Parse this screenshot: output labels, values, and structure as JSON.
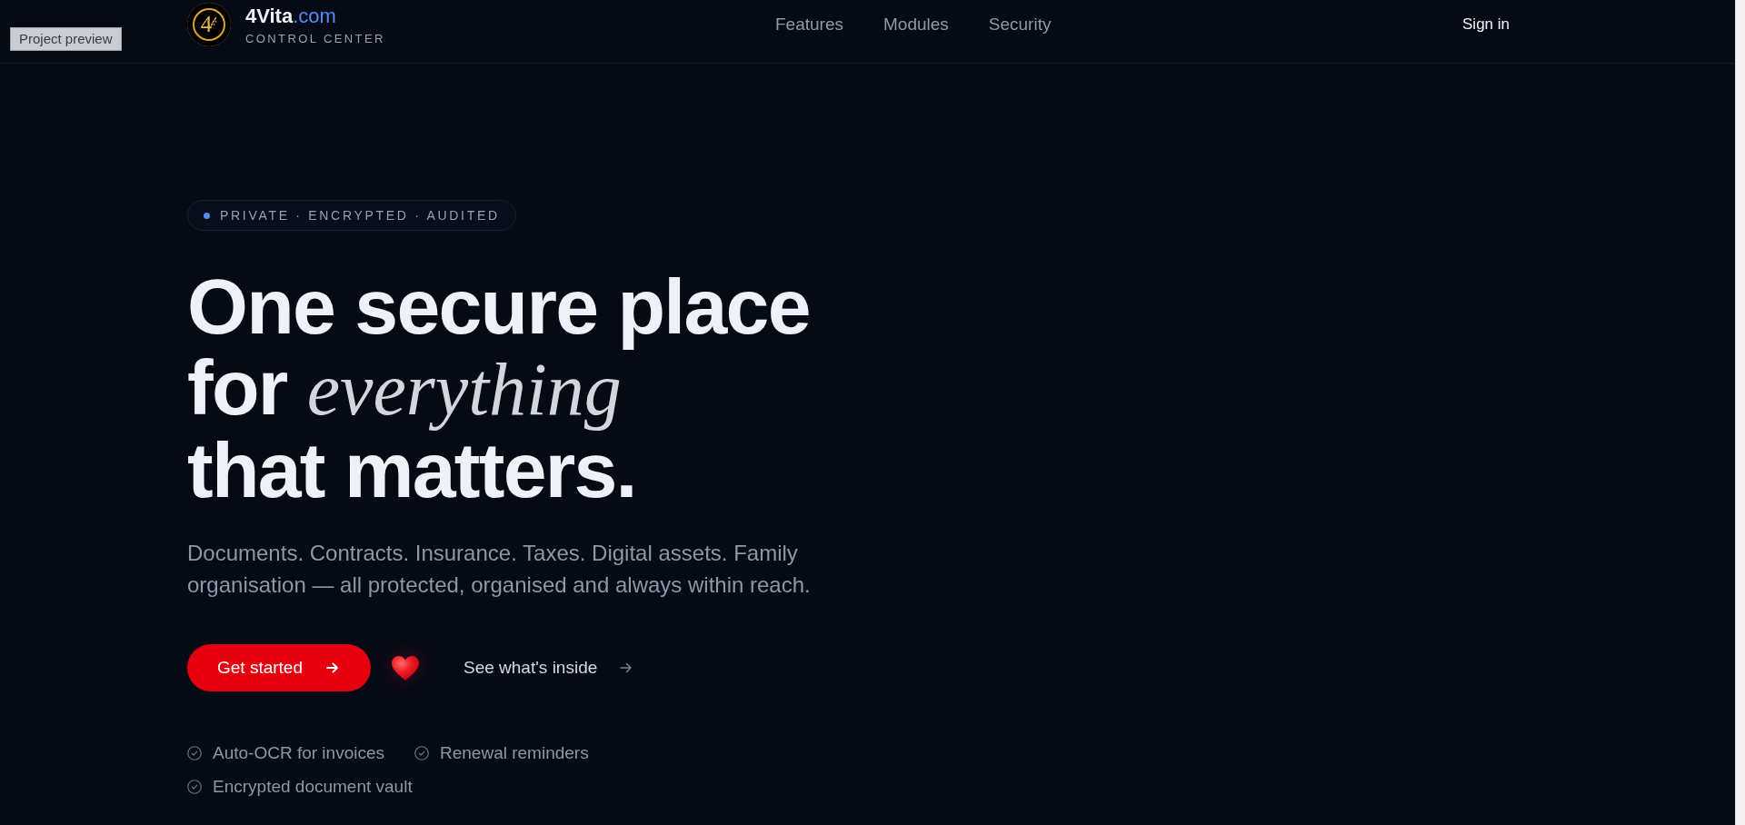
{
  "preview_label": "Project preview",
  "header": {
    "brand": {
      "logo_text": "4",
      "name": "4Vita",
      "domain": ".com",
      "tagline": "CONTROL CENTER"
    },
    "nav": [
      "Features",
      "Modules",
      "Security"
    ],
    "sign_in": "Sign in"
  },
  "hero": {
    "badge": "PRIVATE · ENCRYPTED · AUDITED",
    "headline_lines": [
      "One secure place",
      "for *everything*",
      "that matters."
    ],
    "description": "Documents. Contracts. Insurance. Taxes. Digital assets. Family organisation — all protected, organised and always within reach.",
    "primary_button": "Get started",
    "secondary_link": "See what's inside",
    "highlights": [
      "Auto-OCR for invoices",
      "Renewal reminders",
      "Encrypted document vault"
    ]
  }
}
